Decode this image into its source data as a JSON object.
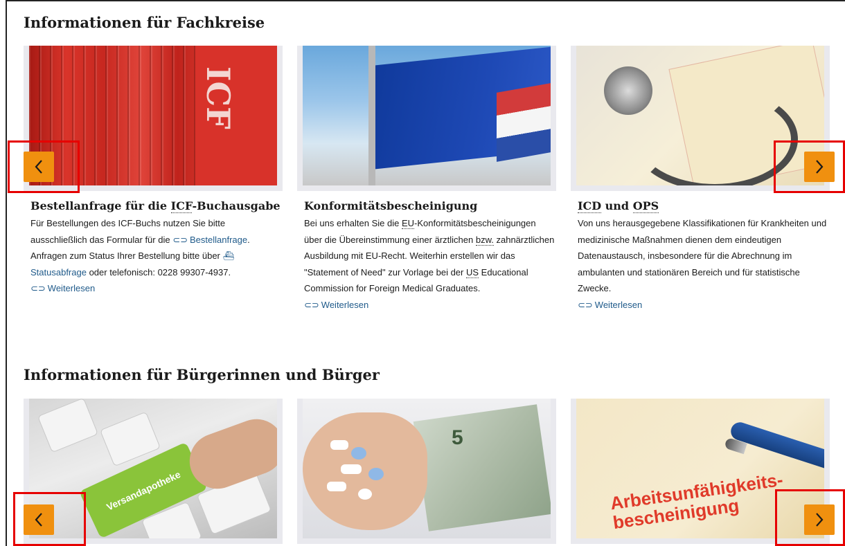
{
  "sections": [
    {
      "title": "Informationen für Fachkreise",
      "cards": [
        {
          "title_pre": "Bestellanfrage für die ",
          "title_abbr": "ICF",
          "title_post": "-Buchausgabe",
          "text_1": "Für Bestellungen des ICF-Buchs nutzen Sie bitte ausschließlich das Formular für die ",
          "link_1": "Bestellanfrage",
          "text_2": ". Anfragen zum Status Ihrer Bestellung bitte über ",
          "link_2": "Statusabfrage",
          "text_3": " oder telefonisch: 0228 99307-4937.",
          "more": "Weiterlesen",
          "image_alt": "ICF"
        },
        {
          "title": "Konformitätsbescheinigung",
          "text_1": "Bei uns erhalten Sie die ",
          "abbr_1": "EU",
          "text_2": "-Konformitätsbescheinigungen über die Übereinstimmung einer ärztlichen ",
          "abbr_2": "bzw.",
          "text_3": " zahnärztlichen Ausbildung mit EU-Recht. Weiterhin erstellen wir das \"Statement of Need\" zur Vorlage bei der ",
          "abbr_3": "US",
          "text_4": " Educational Commission for Foreign Medical Graduates.",
          "more": "Weiterlesen"
        },
        {
          "title_abbr_1": "ICD",
          "title_mid": " und ",
          "title_abbr_2": "OPS",
          "text": "Von uns herausgegebene Klassifikationen für Krankheiten und medizinische Maßnahmen dienen dem eindeutigen Datenaustausch, insbesondere für die Abrechnung im ambulanten und stationären Bereich und für statistische Zwecke.",
          "more": "Weiterlesen"
        }
      ]
    },
    {
      "title": "Informationen für Bürgerinnen und Bürger",
      "cards": [
        {
          "image_text": "Versandapotheke"
        },
        {
          "image_text": "5"
        },
        {
          "image_text": "Arbeitsunfähigkeits-\nbescheinigung"
        }
      ]
    }
  ],
  "icons": {
    "prev": "chevron-left-icon",
    "next": "chevron-right-icon",
    "link": "link-icon",
    "status": "ship-icon"
  },
  "colors": {
    "nav_button": "#f0900f",
    "highlight": "#e60000",
    "link": "#1f5a8a"
  }
}
